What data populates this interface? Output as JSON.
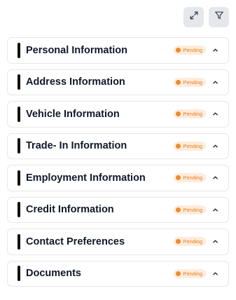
{
  "toolbar": {
    "expand_icon": "expand-arrows-icon",
    "filter_icon": "filter-funnel-icon"
  },
  "status_color": "#ea7b1c",
  "sections": [
    {
      "title": "Personal Information",
      "status": "Pending"
    },
    {
      "title": "Address Information",
      "status": "Pending"
    },
    {
      "title": "Vehicle Information",
      "status": "Pending"
    },
    {
      "title": "Trade- In Information",
      "status": "Pending"
    },
    {
      "title": "Employment Information",
      "status": "Pending"
    },
    {
      "title": "Credit Information",
      "status": "Pending"
    },
    {
      "title": "Contact Preferences",
      "status": "Pending"
    },
    {
      "title": "Documents",
      "status": "Pending"
    }
  ]
}
